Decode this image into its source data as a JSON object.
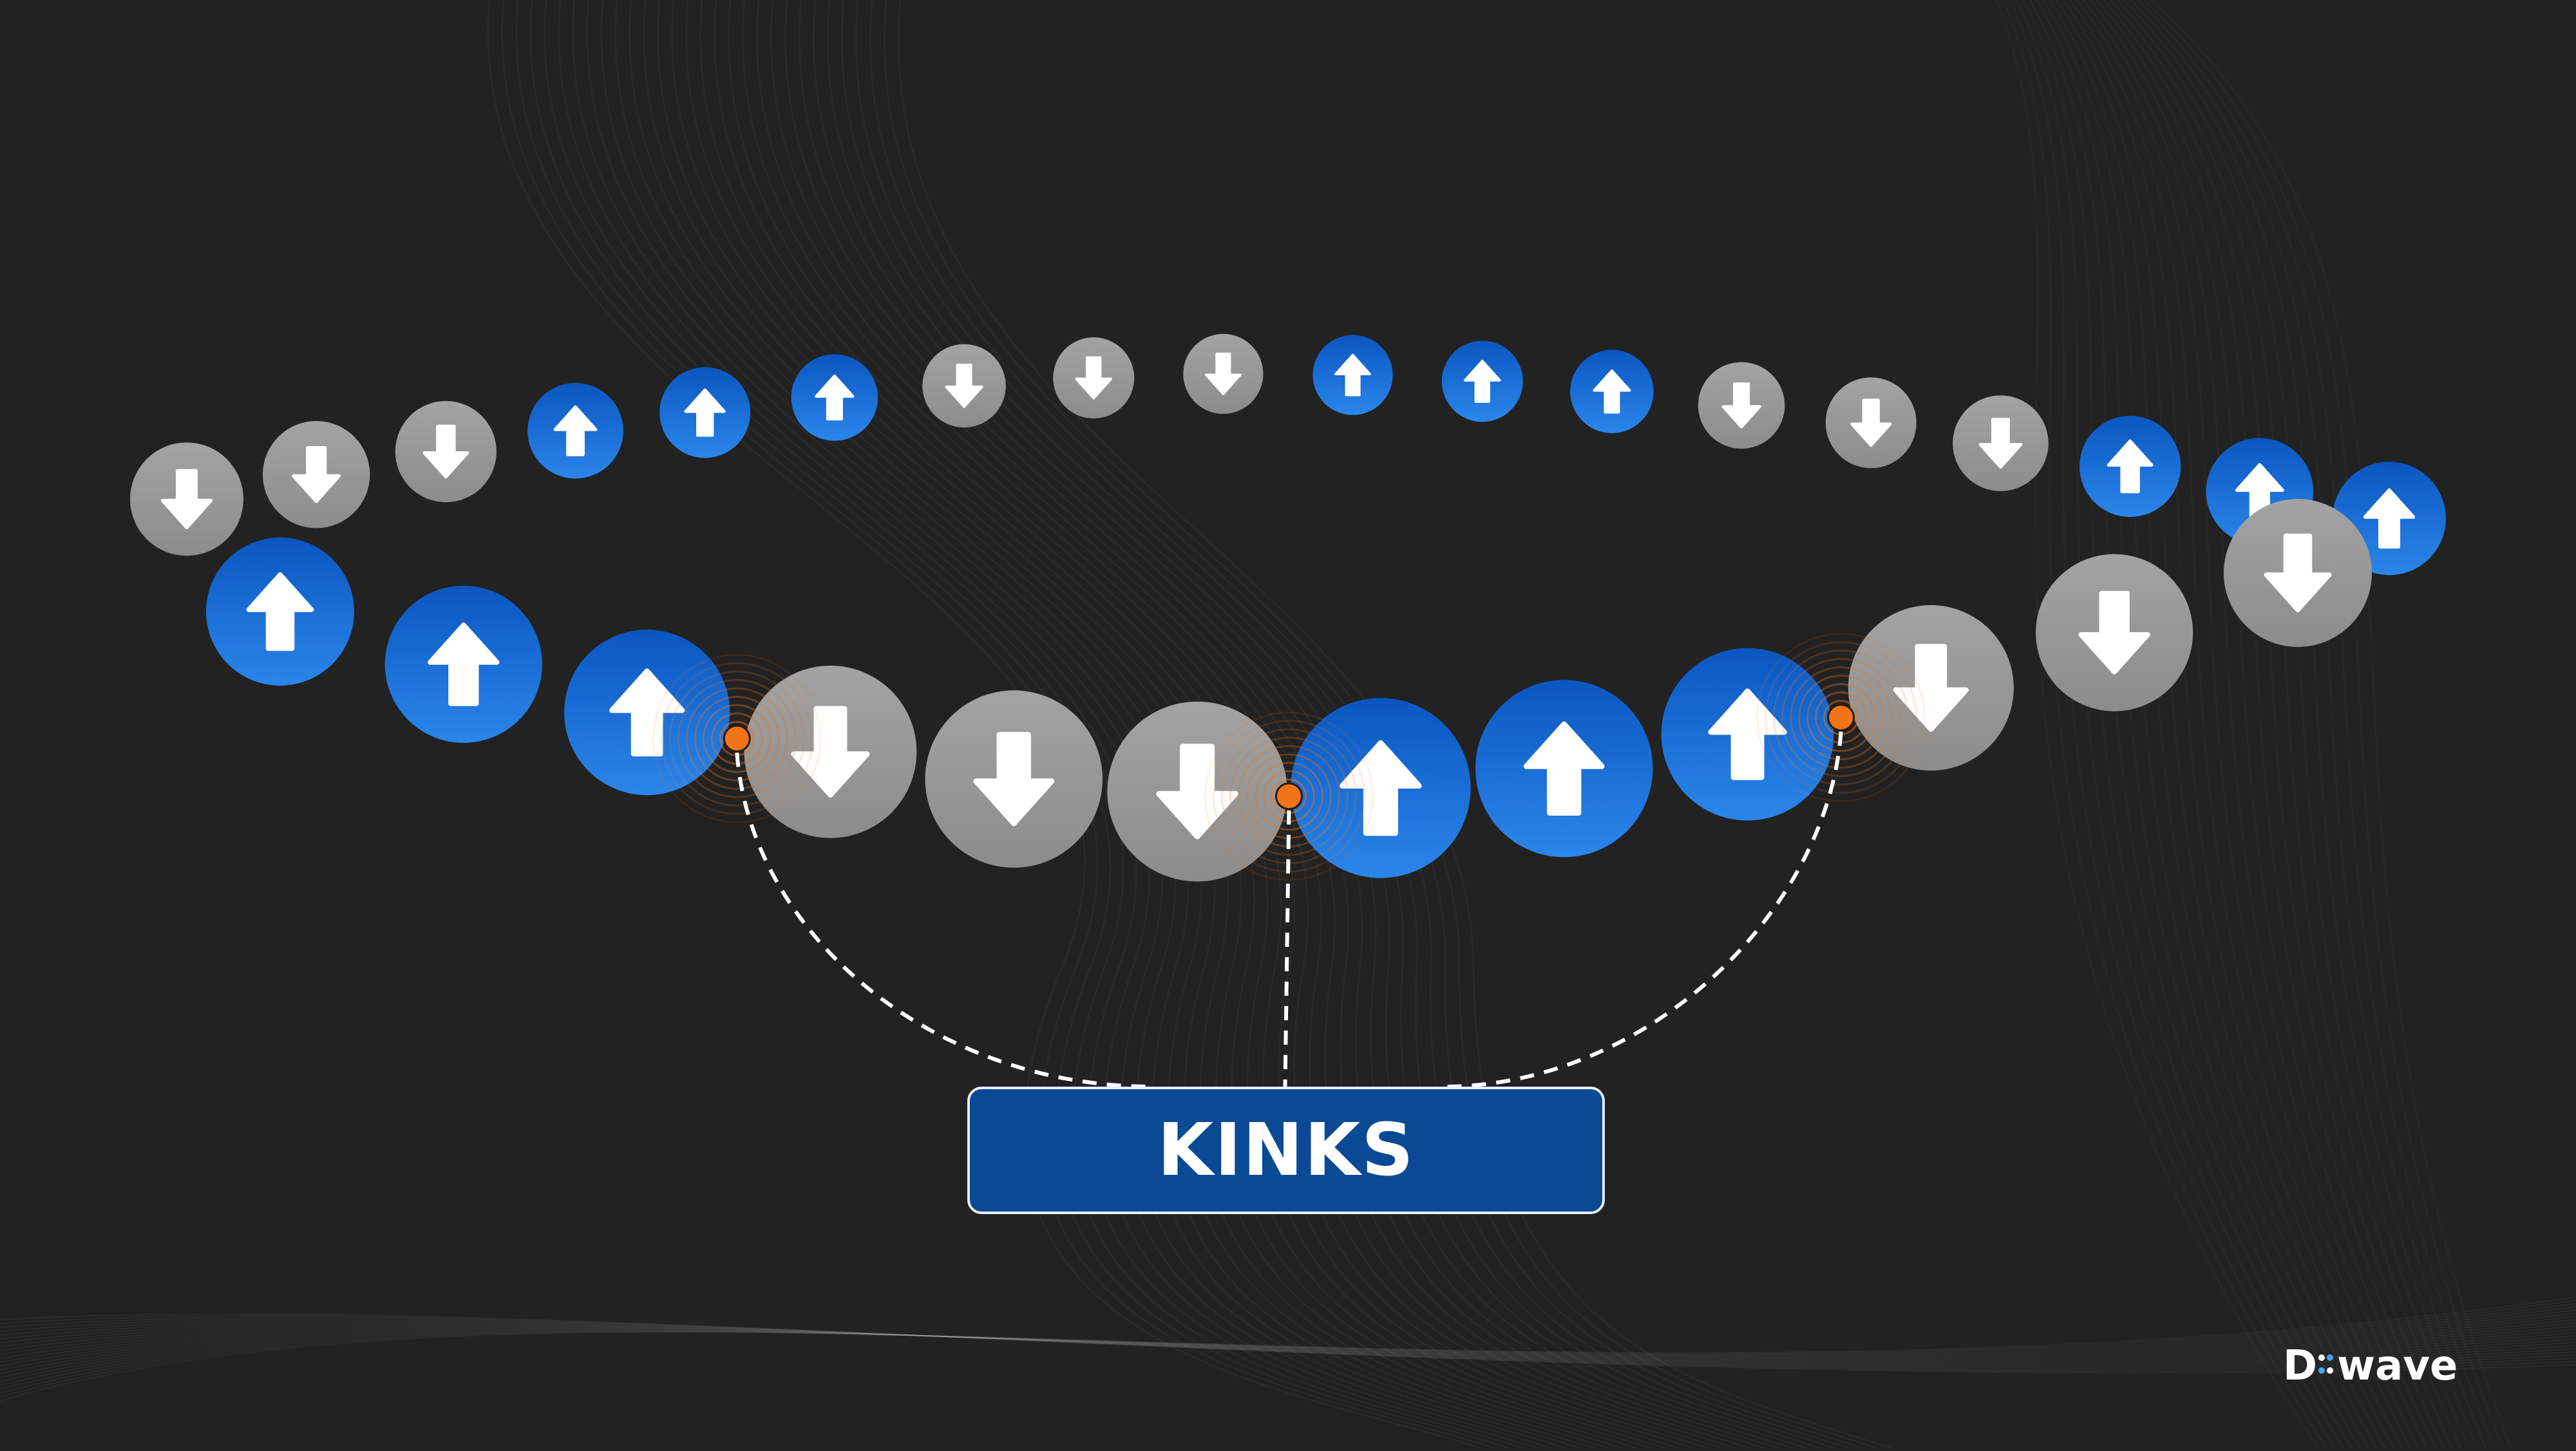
{
  "label": {
    "text": "KINKS"
  },
  "brand": {
    "part1": "D",
    "part2": "wave"
  },
  "colors": {
    "background": "#222222",
    "spin_up": "#1a6fd6",
    "spin_down": "#9e9e9e",
    "arrow": "#ffffff",
    "kink": "#f07418",
    "label_bg": "#0a4a94",
    "connector": "#ffffff"
  },
  "legend_icons": {
    "up": "arrow-up-icon",
    "down": "arrow-down-icon"
  },
  "spin_rings": {
    "back": [
      "down",
      "down",
      "down",
      "up",
      "up",
      "up",
      "down",
      "down",
      "down",
      "up",
      "up",
      "up",
      "down",
      "down",
      "down",
      "up",
      "up",
      "up"
    ],
    "front": [
      "up",
      "up",
      "up",
      "down",
      "down",
      "down",
      "up",
      "up",
      "up",
      "down",
      "down",
      "down"
    ]
  },
  "kinks_between_front_spins": [
    3,
    6,
    9
  ]
}
